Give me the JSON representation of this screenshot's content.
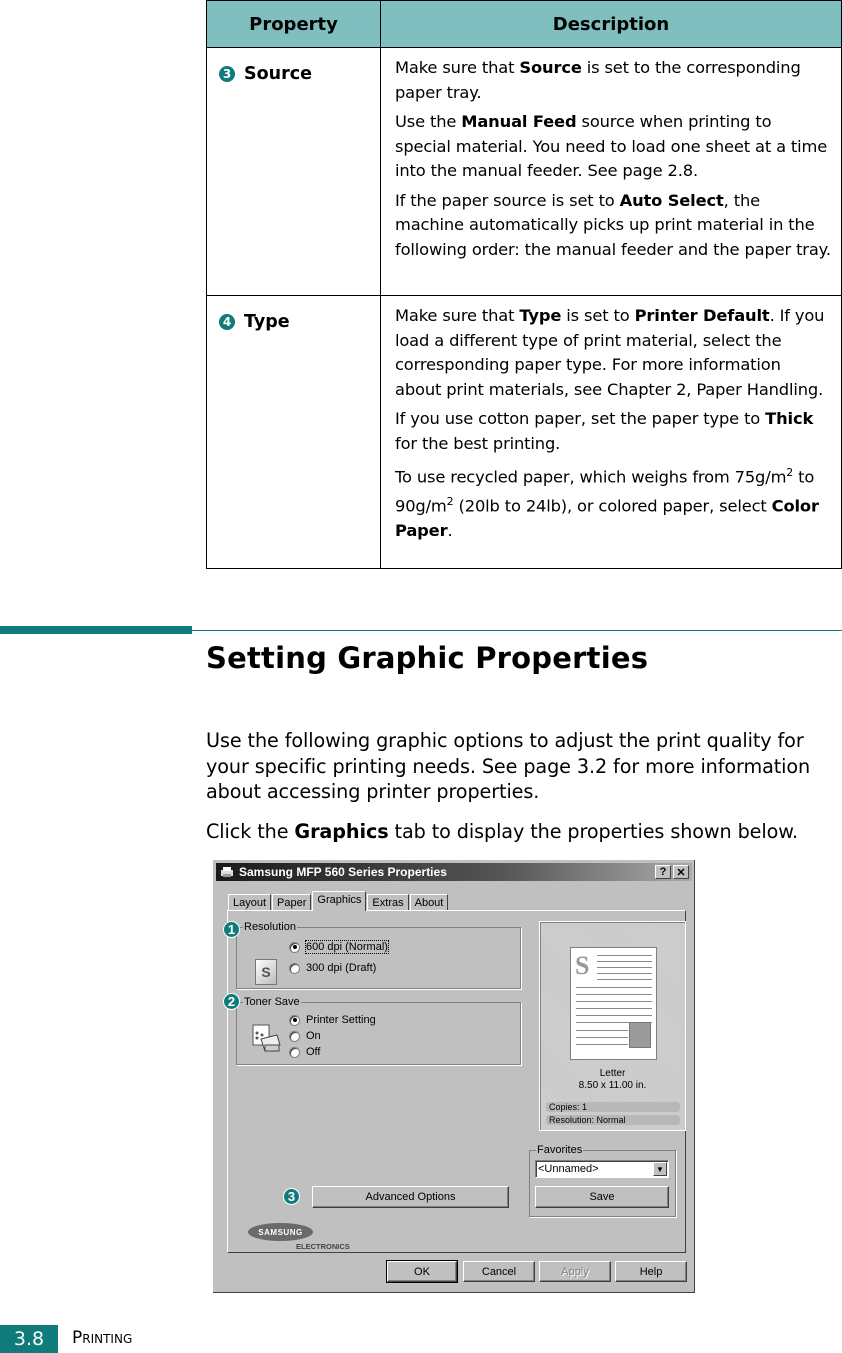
{
  "table": {
    "headers": [
      "Property",
      "Description"
    ],
    "rows": [
      {
        "badge": "3",
        "property": "Source",
        "paragraphs": [
          [
            {
              "t": "Make sure that "
            },
            {
              "b": "Source"
            },
            {
              "t": " is set to the corresponding paper tray."
            }
          ],
          [
            {
              "t": "Use the "
            },
            {
              "b": "Manual Feed"
            },
            {
              "t": " source when printing to special material. You need to load one sheet at a time into the manual feeder. See page 2.8."
            }
          ],
          [
            {
              "t": "If the paper source is set to "
            },
            {
              "b": "Auto Select"
            },
            {
              "t": ", the machine automatically picks up print material in the following order: the manual feeder and the paper tray."
            }
          ]
        ]
      },
      {
        "badge": "4",
        "property": "Type",
        "paragraphs": [
          [
            {
              "t": "Make sure that "
            },
            {
              "b": "Type"
            },
            {
              "t": " is set to "
            },
            {
              "b": "Printer Default"
            },
            {
              "t": ". If you load a different type of print material, select the corresponding paper type. For more information about print materials, see Chapter 2, Paper Handling."
            }
          ],
          [
            {
              "t": "If you use cotton paper, set the paper type to "
            },
            {
              "b": "Thick"
            },
            {
              "t": " for the best printing."
            }
          ],
          [
            {
              "t": "To use recycled paper, which weighs from 75g/m"
            },
            {
              "sup": "2"
            },
            {
              "t": " to 90g/m"
            },
            {
              "sup": "2"
            },
            {
              "t": " (20lb to 24lb), or colored paper, select "
            },
            {
              "b": "Color Paper"
            },
            {
              "t": "."
            }
          ]
        ]
      }
    ]
  },
  "section": {
    "title": "Setting Graphic Properties",
    "intro": "Use the following graphic options to adjust the print quality for your specific printing needs. See page 3.2 for more information about accessing printer properties.",
    "click_prefix": "Click the ",
    "click_bold": "Graphics",
    "click_suffix": " tab to display the properties shown below."
  },
  "dialog": {
    "title": "Samsung MFP 560 Series Properties",
    "help_btn": "?",
    "close_btn": "✕",
    "tabs": [
      "Layout",
      "Paper",
      "Graphics",
      "Extras",
      "About"
    ],
    "active_tab": "Graphics",
    "resolution": {
      "legend": "Resolution",
      "options": [
        "600 dpi (Normal)",
        "300 dpi (Draft)"
      ],
      "selected": "600 dpi (Normal)"
    },
    "toner_save": {
      "legend": "Toner Save",
      "options": [
        "Printer Setting",
        "On",
        "Off"
      ],
      "selected": "Printer Setting"
    },
    "preview": {
      "paper_name": "Letter",
      "paper_size": "8.50 x 11.00 in.",
      "copies": "Copies: 1",
      "resolution": "Resolution: Normal"
    },
    "favorites": {
      "legend": "Favorites",
      "selected": "<Unnamed>",
      "save": "Save"
    },
    "advanced_options": "Advanced Options",
    "logo_text": "SAMSUNG",
    "logo_sub": "ELECTRONICS",
    "buttons": [
      "OK",
      "Cancel",
      "Apply",
      "Help"
    ],
    "callouts": [
      "1",
      "2",
      "3"
    ]
  },
  "footer": {
    "page_number": "3.8",
    "chapter": "Printing"
  },
  "colors": {
    "accent": "#0f7b7b",
    "table_header": "#7fbfbf",
    "dialog_face": "#c0c0c0"
  }
}
